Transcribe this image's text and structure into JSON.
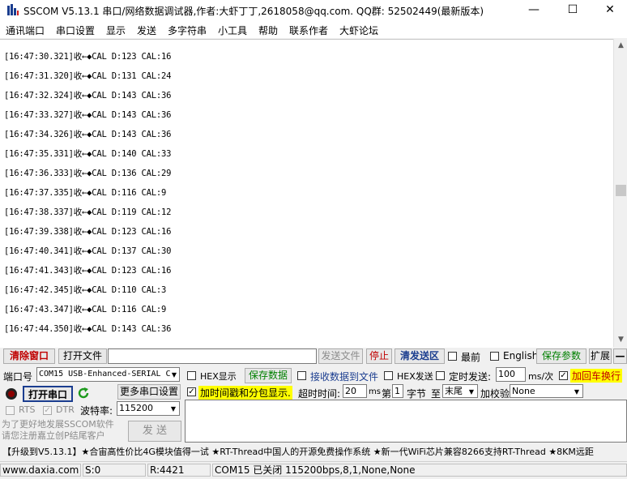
{
  "window": {
    "title": "SSCOM V5.13.1 串口/网络数据调试器,作者:大虾丁丁,2618058@qq.com. QQ群: 52502449(最新版本)",
    "minimize": "—",
    "maximize": "☐",
    "close": "✕"
  },
  "menu": [
    "通讯端口",
    "串口设置",
    "显示",
    "发送",
    "多字符串",
    "小工具",
    "帮助",
    "联系作者",
    "大虾论坛"
  ],
  "log": [
    "[16:47:30.321]收←◆CAL D:123 CAL:16",
    "[16:47:31.320]收←◆CAL D:131 CAL:24",
    "[16:47:32.324]收←◆CAL D:143 CAL:36",
    "[16:47:33.327]收←◆CAL D:143 CAL:36",
    "[16:47:34.326]收←◆CAL D:143 CAL:36",
    "[16:47:35.331]收←◆CAL D:140 CAL:33",
    "[16:47:36.333]收←◆CAL D:136 CAL:29",
    "[16:47:37.335]收←◆CAL D:116 CAL:9",
    "[16:47:38.337]收←◆CAL D:119 CAL:12",
    "[16:47:39.338]收←◆CAL D:123 CAL:16",
    "[16:47:40.341]收←◆CAL D:137 CAL:30",
    "[16:47:41.343]收←◆CAL D:123 CAL:16",
    "[16:47:42.345]收←◆CAL D:110 CAL:3",
    "[16:47:43.347]收←◆CAL D:116 CAL:9",
    "[16:47:44.350]收←◆CAL D:143 CAL:36"
  ],
  "toolbar": {
    "clear_window": "清除窗口",
    "open_file": "打开文件",
    "file_path": "",
    "send_file": "发送文件",
    "stop": "停止",
    "clear_send": "清发送区",
    "topmost": "最前",
    "english": "English",
    "save_params": "保存参数",
    "expand": "扩展",
    "collapse": "—"
  },
  "settings": {
    "port_label": "端口号",
    "port_value": "COM15 USB-Enhanced-SERIAL C",
    "hex_display": "HEX显示",
    "save_data": "保存数据",
    "recv_to_file": "接收数据到文件",
    "hex_send": "HEX发送",
    "timed_send": "定时发送:",
    "interval": "100",
    "interval_unit": "ms/次",
    "append_newline": "加回车换行",
    "more_settings": "更多串口设置",
    "add_timestamp": "加时间戳和分包显示.",
    "timeout_label": "超时时间:",
    "timeout_value": "20",
    "timeout_unit": "ms",
    "byte_prefix": "第",
    "byte_index": "1",
    "byte_suffix": "字节",
    "to_label": "至",
    "end_value": "末尾",
    "checksum_label": "加校验",
    "checksum_value": "None",
    "open_port": "打开串口",
    "rts": "RTS",
    "dtr": "DTR",
    "baud_label": "波特率:",
    "baud_value": "115200",
    "promo": "为了更好地发展SSCOM软件\n请您注册嘉立创P结尾客户",
    "send": "发 送",
    "send_text": ""
  },
  "ticker": "【升级到V5.13.1】★合宙高性价比4G模块值得一试 ★RT-Thread中国人的开源免费操作系统 ★新一代WiFi芯片兼容8266支持RT-Thread ★8KM远距",
  "status": {
    "website": "www.daxia.com",
    "sent": "S:0",
    "received": "R:4421",
    "port_state": "COM15 已关闭  115200bps,8,1,None,None"
  },
  "colors": {
    "accent_red": "#c00000",
    "accent_green": "#008000",
    "highlight": "#ffff00"
  }
}
